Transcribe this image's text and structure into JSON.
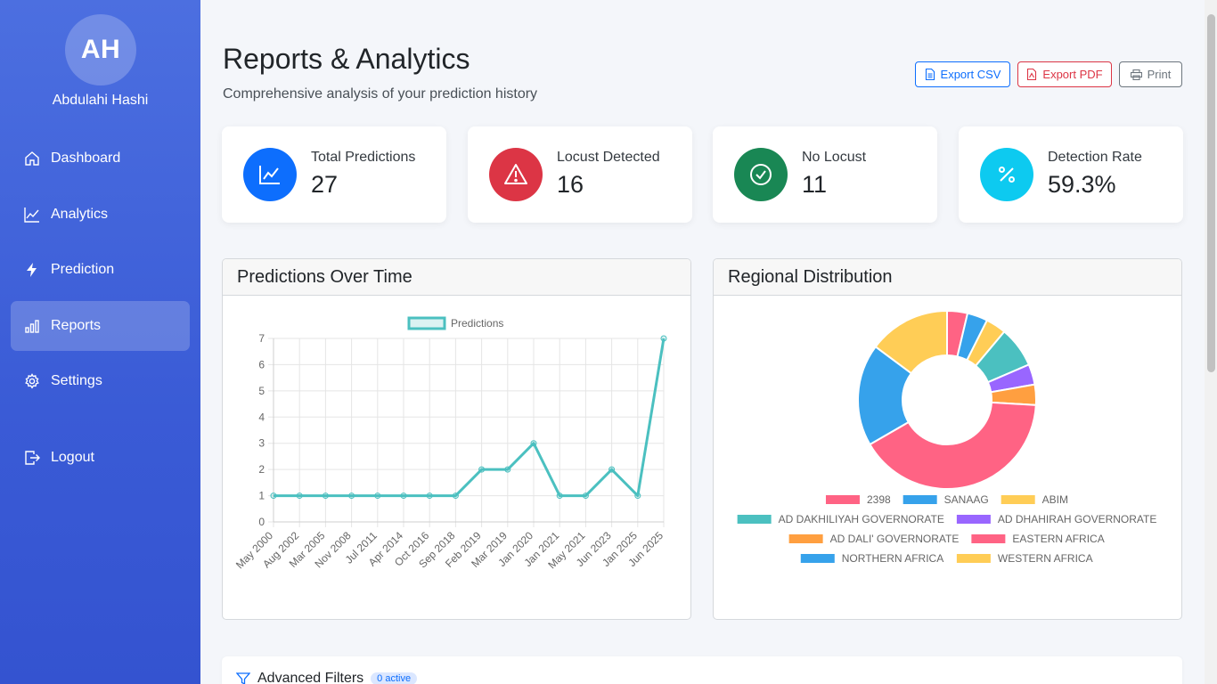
{
  "user": {
    "initials": "AH",
    "name": "Abdulahi Hashi"
  },
  "nav": [
    {
      "label": "Dashboard",
      "icon": "home-icon"
    },
    {
      "label": "Analytics",
      "icon": "chart-line-icon"
    },
    {
      "label": "Prediction",
      "icon": "lightning-icon"
    },
    {
      "label": "Reports",
      "icon": "bar-chart-icon",
      "active": true
    },
    {
      "label": "Settings",
      "icon": "gear-icon"
    },
    {
      "label": "Logout",
      "icon": "logout-icon"
    }
  ],
  "header": {
    "title": "Reports & Analytics",
    "subtitle": "Comprehensive analysis of your prediction history",
    "buttons": {
      "csv": "Export CSV",
      "pdf": "Export PDF",
      "print": "Print"
    }
  },
  "stats": [
    {
      "label": "Total Predictions",
      "value": "27",
      "color": "#0d6efd"
    },
    {
      "label": "Locust Detected",
      "value": "16",
      "color": "#dc3545"
    },
    {
      "label": "No Locust",
      "value": "11",
      "color": "#198754"
    },
    {
      "label": "Detection Rate",
      "value": "59.3%",
      "color": "#0dcaf0"
    }
  ],
  "panels": {
    "time": "Predictions Over Time",
    "region": "Regional Distribution"
  },
  "filters": {
    "title": "Advanced Filters",
    "badge": "0 active"
  },
  "chart_data": [
    {
      "type": "line",
      "categories": [
        "May 2000",
        "Aug 2002",
        "Mar 2005",
        "Nov 2008",
        "Jul 2011",
        "Apr 2014",
        "Oct 2016",
        "Sep 2018",
        "Feb 2019",
        "Mar 2019",
        "Jan 2020",
        "Jan 2021",
        "May 2021",
        "Jun 2023",
        "Jan 2025",
        "Jun 2025"
      ],
      "series": [
        {
          "name": "Predictions",
          "values": [
            1,
            1,
            1,
            1,
            1,
            1,
            1,
            1,
            2,
            2,
            3,
            1,
            1,
            2,
            1,
            7
          ],
          "color": "#4bc0c0"
        }
      ],
      "ylim": [
        0,
        7
      ],
      "yticks": [
        "0",
        "1",
        "2",
        "3",
        "4",
        "5",
        "6",
        "7"
      ],
      "legend": "top",
      "grid": true
    },
    {
      "type": "pie",
      "donut": true,
      "labels": [
        "2398",
        "SANAAG",
        "ABIM",
        "AD DAKHILIYAH GOVERNORATE",
        "AD DHAHIRAH GOVERNORATE",
        "AD DALI' GOVERNORATE",
        "EASTERN AFRICA",
        "NORTHERN AFRICA",
        "WESTERN AFRICA"
      ],
      "values": [
        1,
        1,
        1,
        2,
        1,
        1,
        11,
        5,
        4
      ],
      "colors": [
        "#ff6384",
        "#36a2eb",
        "#ffcd56",
        "#4bc0c0",
        "#9966ff",
        "#ff9f40",
        "#ff6384",
        "#36a2eb",
        "#ffcd56"
      ],
      "legend": "bottom"
    }
  ]
}
